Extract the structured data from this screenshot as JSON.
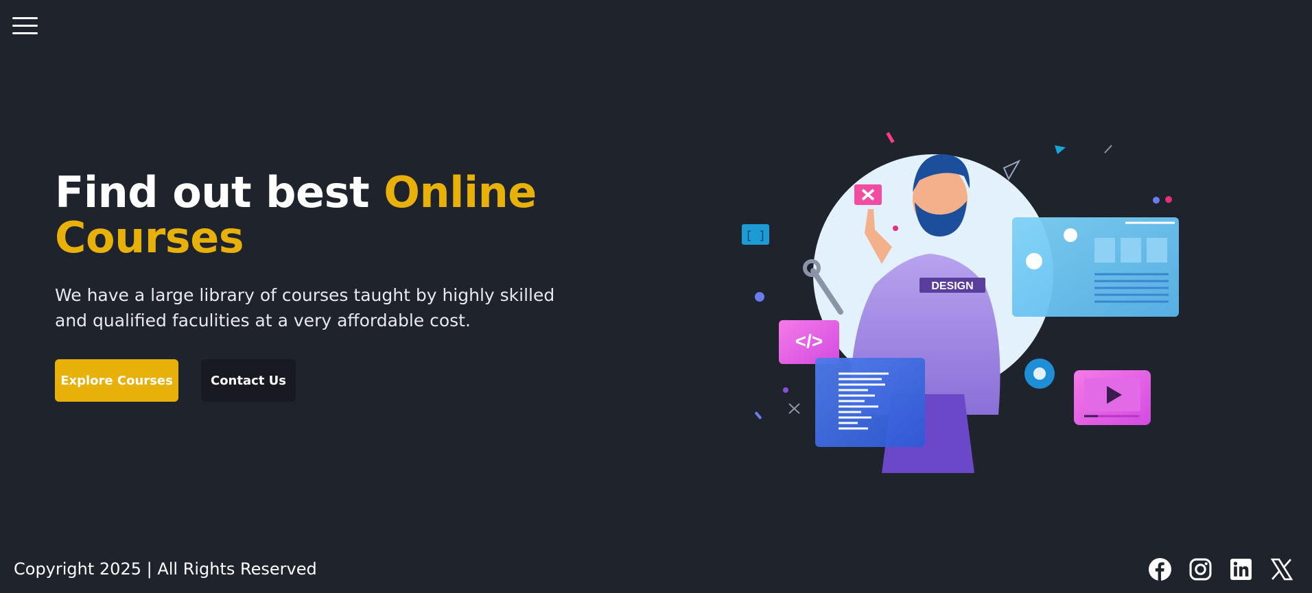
{
  "nav": {
    "menu_icon": "hamburger-menu-icon"
  },
  "hero": {
    "title_part1": "Find out best ",
    "title_accent": "Online Courses",
    "subtitle": "We have a large library of courses taught by highly skilled and qualified faculities at a very affordable cost.",
    "primary_button": "Explore Courses",
    "secondary_button": "Contact Us",
    "illustration_badge": "DESIGN",
    "illustration_bracket": "[ ]"
  },
  "footer": {
    "copyright": "Copyright 2025 | All Rights Reserved",
    "social_icons": [
      "facebook-icon",
      "instagram-icon",
      "linkedin-icon",
      "x-icon"
    ]
  },
  "colors": {
    "background": "#1e232c",
    "accent": "#e8b10a",
    "dark_button": "#171b21",
    "text": "#ffffff"
  }
}
